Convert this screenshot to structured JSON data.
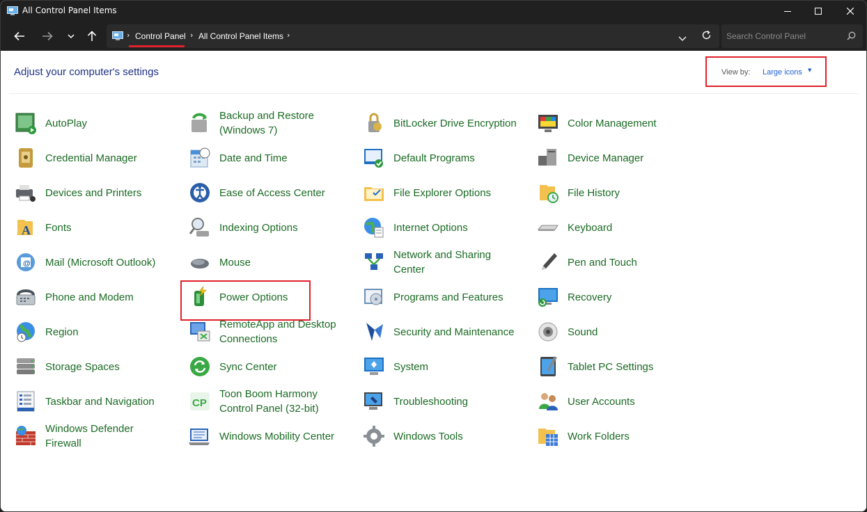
{
  "window": {
    "title": "All Control Panel Items"
  },
  "breadcrumb": {
    "items": [
      "Control Panel",
      "All Control Panel Items"
    ]
  },
  "search": {
    "placeholder": "Search Control Panel"
  },
  "header": {
    "title": "Adjust your computer's settings",
    "view_by_label": "View by:",
    "view_by_value": "Large icons"
  },
  "colors": {
    "link_green": "#1b6a24",
    "heading_blue": "#1e3287",
    "annotation_red": "#e0202a",
    "chrome_dark": "#202020"
  },
  "items": [
    {
      "label": "AutoPlay",
      "icon": "autoplay-icon"
    },
    {
      "label": "Backup and Restore\n(Windows 7)",
      "icon": "backup-restore-icon"
    },
    {
      "label": "BitLocker Drive Encryption",
      "icon": "bitlocker-icon"
    },
    {
      "label": "Color Management",
      "icon": "color-management-icon"
    },
    {
      "label": "Credential Manager",
      "icon": "credential-manager-icon"
    },
    {
      "label": "Date and Time",
      "icon": "date-time-icon"
    },
    {
      "label": "Default Programs",
      "icon": "default-programs-icon"
    },
    {
      "label": "Device Manager",
      "icon": "device-manager-icon"
    },
    {
      "label": "Devices and Printers",
      "icon": "devices-printers-icon"
    },
    {
      "label": "Ease of Access Center",
      "icon": "ease-of-access-icon"
    },
    {
      "label": "File Explorer Options",
      "icon": "file-explorer-options-icon"
    },
    {
      "label": "File History",
      "icon": "file-history-icon"
    },
    {
      "label": "Fonts",
      "icon": "fonts-icon"
    },
    {
      "label": "Indexing Options",
      "icon": "indexing-options-icon"
    },
    {
      "label": "Internet Options",
      "icon": "internet-options-icon"
    },
    {
      "label": "Keyboard",
      "icon": "keyboard-icon"
    },
    {
      "label": "Mail (Microsoft Outlook)",
      "icon": "mail-icon"
    },
    {
      "label": "Mouse",
      "icon": "mouse-icon"
    },
    {
      "label": "Network and Sharing\nCenter",
      "icon": "network-sharing-icon"
    },
    {
      "label": "Pen and Touch",
      "icon": "pen-touch-icon"
    },
    {
      "label": "Phone and Modem",
      "icon": "phone-modem-icon"
    },
    {
      "label": "Power Options",
      "icon": "power-options-icon"
    },
    {
      "label": "Programs and Features",
      "icon": "programs-features-icon"
    },
    {
      "label": "Recovery",
      "icon": "recovery-icon"
    },
    {
      "label": "Region",
      "icon": "region-icon"
    },
    {
      "label": "RemoteApp and Desktop\nConnections",
      "icon": "remoteapp-icon"
    },
    {
      "label": "Security and Maintenance",
      "icon": "security-maintenance-icon"
    },
    {
      "label": "Sound",
      "icon": "sound-icon"
    },
    {
      "label": "Storage Spaces",
      "icon": "storage-spaces-icon"
    },
    {
      "label": "Sync Center",
      "icon": "sync-center-icon"
    },
    {
      "label": "System",
      "icon": "system-icon"
    },
    {
      "label": "Tablet PC Settings",
      "icon": "tablet-pc-icon"
    },
    {
      "label": "Taskbar and Navigation",
      "icon": "taskbar-navigation-icon"
    },
    {
      "label": "Toon Boom Harmony\nControl Panel (32-bit)",
      "icon": "toon-boom-icon"
    },
    {
      "label": "Troubleshooting",
      "icon": "troubleshooting-icon"
    },
    {
      "label": "User Accounts",
      "icon": "user-accounts-icon"
    },
    {
      "label": "Windows Defender\nFirewall",
      "icon": "firewall-icon"
    },
    {
      "label": "Windows Mobility Center",
      "icon": "mobility-center-icon"
    },
    {
      "label": "Windows Tools",
      "icon": "windows-tools-icon"
    },
    {
      "label": "Work Folders",
      "icon": "work-folders-icon"
    }
  ]
}
